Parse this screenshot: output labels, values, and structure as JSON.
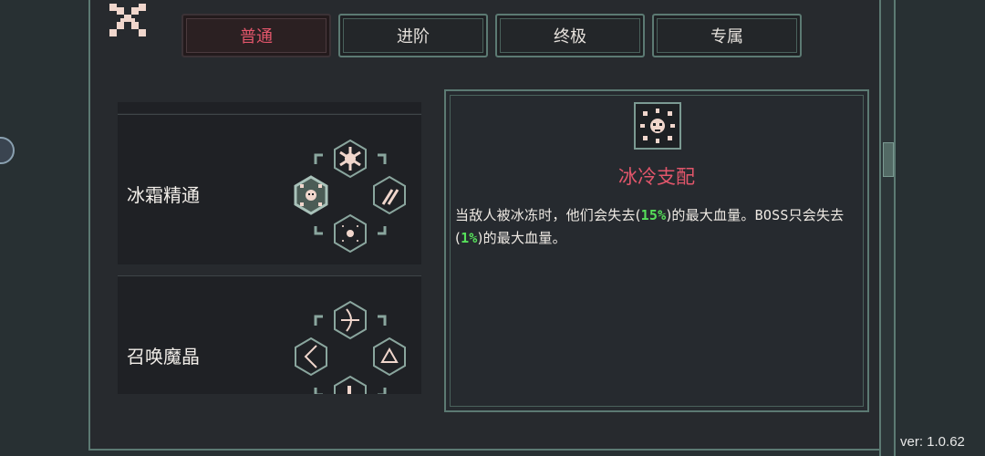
{
  "tabs": [
    {
      "label": "普通",
      "active": true
    },
    {
      "label": "进阶",
      "active": false
    },
    {
      "label": "终极",
      "active": false
    },
    {
      "label": "专属",
      "active": false
    }
  ],
  "list": {
    "items": [
      {
        "name": "冰霜精通"
      },
      {
        "name": "召唤魔晶"
      }
    ]
  },
  "detail": {
    "title": "冰冷支配",
    "desc_part1": "当敌人被冰冻时，他们会失去(",
    "desc_value1": "15%",
    "desc_part2": ")的最大血量。",
    "desc_boss": "BOSS",
    "desc_part3": "只会失去(",
    "desc_value2": "1%",
    "desc_part4": ")的最大血量。"
  },
  "colors": {
    "accent_red": "#e2566b",
    "highlight_green": "#56e05a",
    "frame_teal": "#5c7a73"
  },
  "icons": [
    "close-icon",
    "snowflake-icon",
    "skull-snowflake-icon",
    "feather-icon",
    "frost-orb-icon",
    "arrow-icon",
    "bow-icon",
    "prism-icon",
    "crystal-icon"
  ],
  "version": "ver: 1.0.62"
}
